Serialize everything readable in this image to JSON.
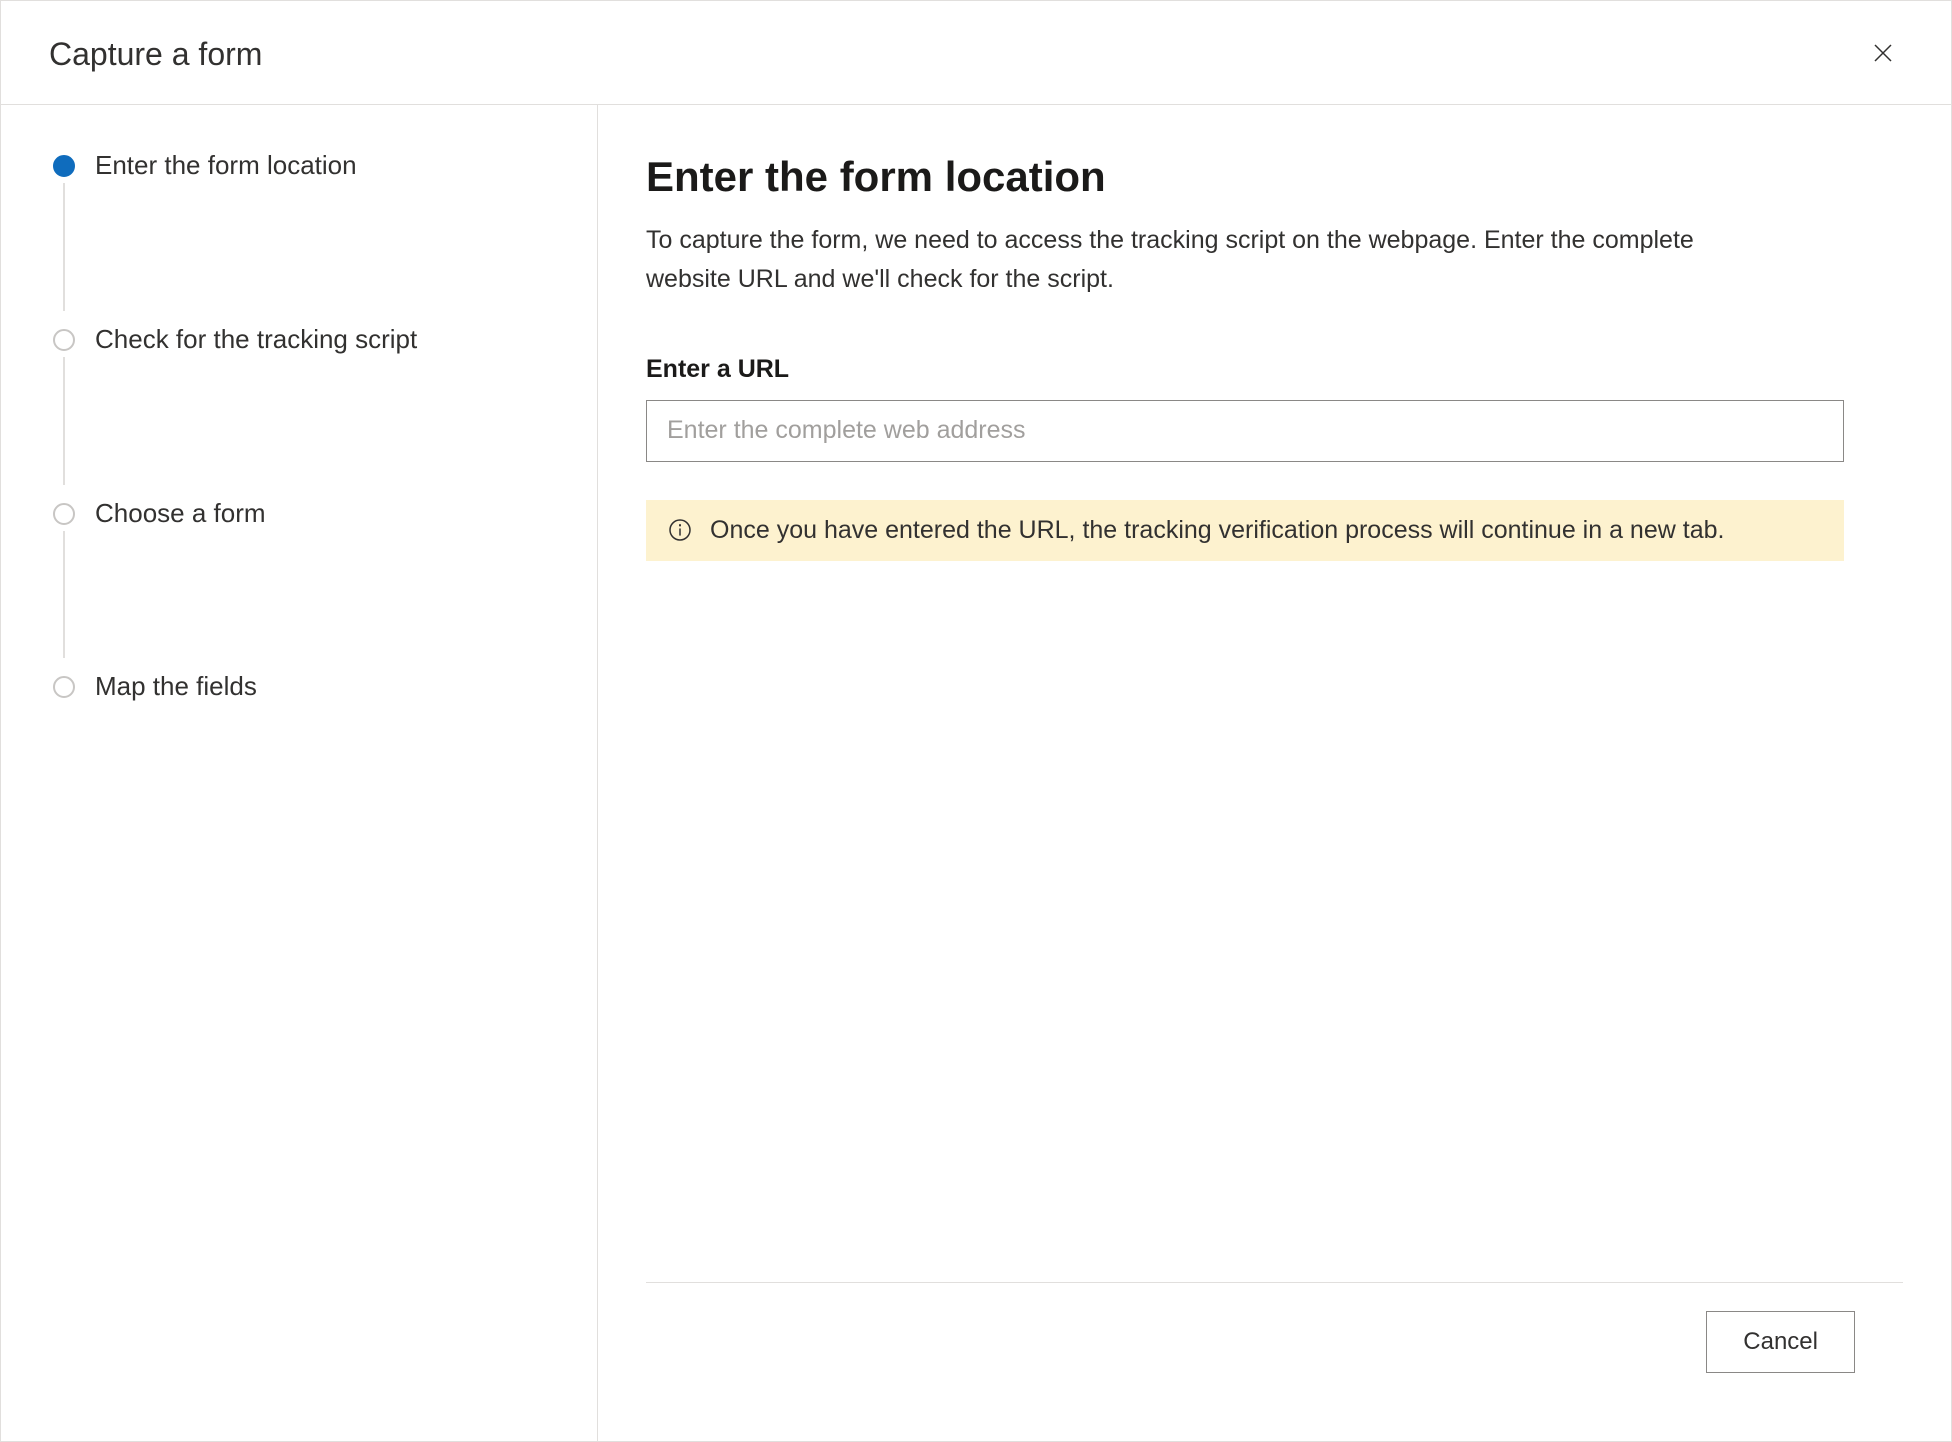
{
  "dialog": {
    "title": "Capture a form"
  },
  "sidebar": {
    "steps": [
      {
        "label": "Enter the form location"
      },
      {
        "label": "Check for the tracking script"
      },
      {
        "label": "Choose a form"
      },
      {
        "label": "Map the fields"
      }
    ]
  },
  "main": {
    "title": "Enter the form location",
    "description": "To capture the form, we need to access the tracking script on the webpage. Enter the complete website URL and we'll check for the script.",
    "url_label": "Enter a URL",
    "url_placeholder": "Enter the complete web address",
    "url_value": "",
    "info_text": "Once you have entered the URL, the tracking verification process will continue in a new tab."
  },
  "footer": {
    "cancel_label": "Cancel"
  }
}
